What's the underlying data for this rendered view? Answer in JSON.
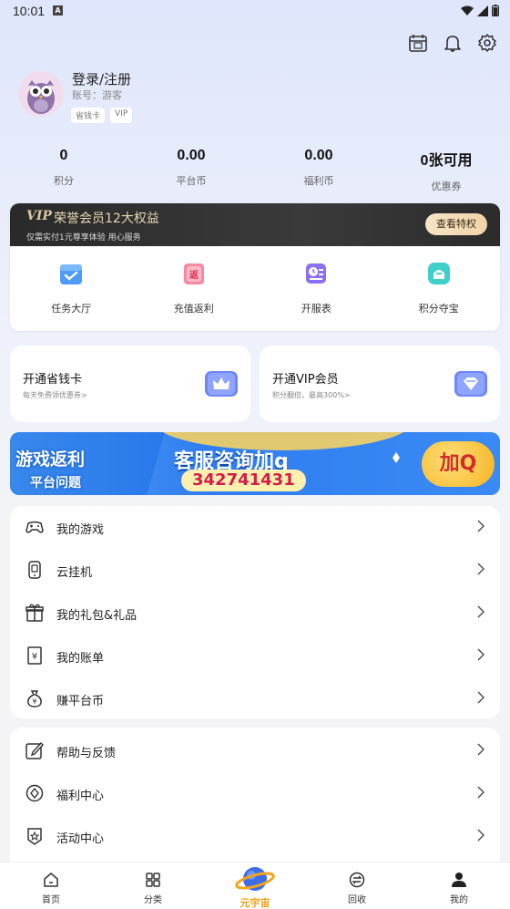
{
  "status": {
    "time": "10:01"
  },
  "profile": {
    "login": "登录/注册",
    "account": "账号：游客",
    "badges": [
      "省钱卡",
      "VIP"
    ]
  },
  "stats": [
    {
      "value": "0",
      "label": "积分"
    },
    {
      "value": "0.00",
      "label": "平台币"
    },
    {
      "value": "0.00",
      "label": "福利币"
    },
    {
      "value": "0张可用",
      "label": "优惠券"
    }
  ],
  "vip": {
    "logo": "VIP",
    "title": "荣誉会员12大权益",
    "subtitle": "仅需实付1元尊享体验 用心服务",
    "button": "查看特权",
    "items": [
      {
        "label": "任务大厅",
        "icon": "task-hall-icon"
      },
      {
        "label": "充值返利",
        "icon": "recharge-rebate-icon"
      },
      {
        "label": "开服表",
        "icon": "server-schedule-icon"
      },
      {
        "label": "积分夺宝",
        "icon": "points-treasure-icon"
      }
    ]
  },
  "promos": {
    "left": {
      "title": "开通省钱卡",
      "subtitle": "每天免费领优惠券>"
    },
    "right": {
      "title": "开通VIP会员",
      "subtitle": "积分翻倍，最高300%>"
    }
  },
  "banner": {
    "tag1": "游戏返利",
    "tag2": "平台问题",
    "main": "客服咨询加q",
    "qq": "342741431",
    "add": "加Q"
  },
  "menu1": [
    {
      "label": "我的游戏",
      "icon": "gamepad-icon"
    },
    {
      "label": "云挂机",
      "icon": "cloud-phone-icon"
    },
    {
      "label": "我的礼包&礼品",
      "icon": "gift-icon"
    },
    {
      "label": "我的账单",
      "icon": "bill-icon"
    },
    {
      "label": "赚平台币",
      "icon": "money-bag-icon"
    }
  ],
  "menu2": [
    {
      "label": "帮助与反馈",
      "icon": "feedback-edit-icon"
    },
    {
      "label": "福利中心",
      "icon": "welfare-icon"
    },
    {
      "label": "活动中心",
      "icon": "activity-icon"
    }
  ],
  "tabs": [
    {
      "label": "首页",
      "icon": "home-icon"
    },
    {
      "label": "分类",
      "icon": "category-icon"
    },
    {
      "label": "元宇宙",
      "icon": "planet-icon"
    },
    {
      "label": "回收",
      "icon": "recycle-icon"
    },
    {
      "label": "我的",
      "icon": "user-icon"
    }
  ]
}
